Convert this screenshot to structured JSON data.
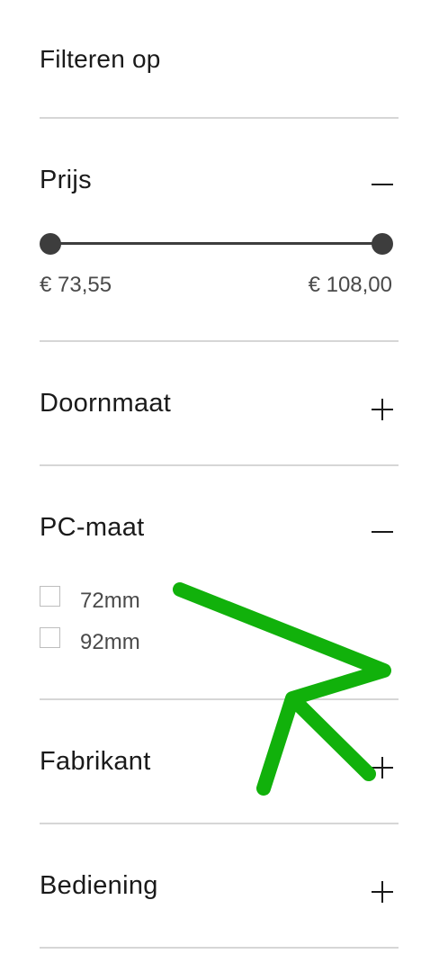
{
  "filter": {
    "heading": "Filteren op",
    "sections": {
      "price": {
        "title": "Prijs",
        "state": "expanded"
      },
      "doornmaat": {
        "title": "Doornmaat",
        "state": "collapsed"
      },
      "pcmaat": {
        "title": "PC-maat",
        "state": "expanded"
      },
      "fabrikant": {
        "title": "Fabrikant",
        "state": "collapsed"
      },
      "bediening": {
        "title": "Bediening",
        "state": "collapsed"
      }
    },
    "price_range": {
      "min_label": "€ 73,55",
      "max_label": "€ 108,00",
      "selected_low_fraction": 0,
      "selected_high_fraction": 1
    },
    "pc_options": [
      {
        "label": "72mm",
        "checked": false
      },
      {
        "label": "92mm",
        "checked": false
      }
    ]
  },
  "icons": {
    "expanded": "minus-icon",
    "collapsed": "plus-icon",
    "pointer": "arrow-cursor-icon"
  },
  "colors": {
    "text": "#1a1a1a",
    "muted_text": "#4a4a4a",
    "divider": "#d6d6d6",
    "slider": "#3d3d3d",
    "checkbox_border": "#bdbdbd",
    "cursor": "#11b10b"
  }
}
